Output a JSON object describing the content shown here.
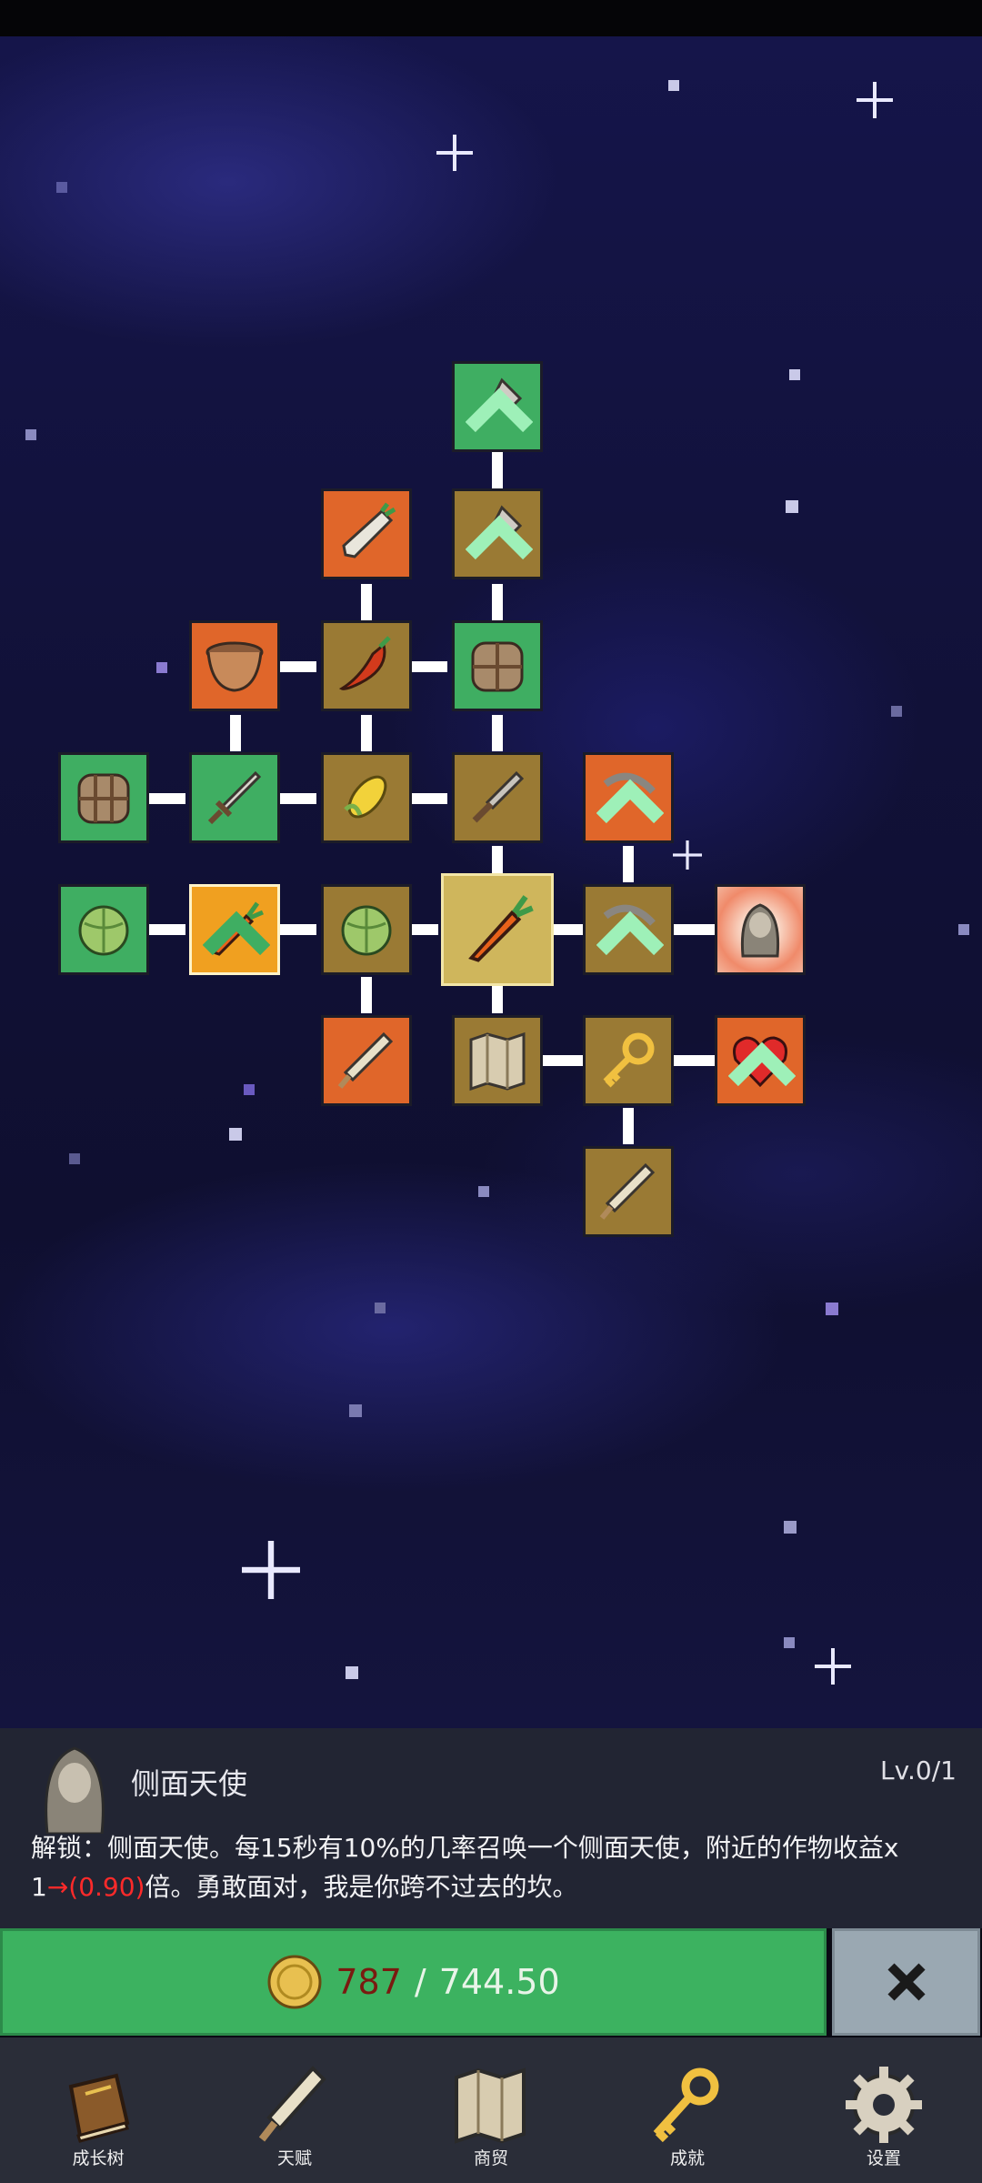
{
  "skill_tree": {
    "nodes": [
      {
        "id": "shovel-top",
        "icon": "shovel-icon",
        "color": "green",
        "upgrade": true
      },
      {
        "id": "radish",
        "icon": "radish-icon",
        "color": "orange",
        "upgrade": false
      },
      {
        "id": "shovel",
        "icon": "shovel-icon",
        "color": "gold",
        "upgrade": true
      },
      {
        "id": "pot",
        "icon": "pot-icon",
        "color": "orange",
        "upgrade": false
      },
      {
        "id": "chili",
        "icon": "chili-icon",
        "color": "gold",
        "upgrade": false
      },
      {
        "id": "bag-top",
        "icon": "bag-icon",
        "color": "green",
        "upgrade": false
      },
      {
        "id": "bag-left",
        "icon": "bag-icon",
        "color": "green",
        "upgrade": false
      },
      {
        "id": "sword",
        "icon": "sword-icon",
        "color": "green",
        "upgrade": false
      },
      {
        "id": "corn",
        "icon": "corn-icon",
        "color": "gold",
        "upgrade": false
      },
      {
        "id": "sickle",
        "icon": "sickle-icon",
        "color": "gold",
        "upgrade": false
      },
      {
        "id": "pickaxe-top",
        "icon": "pickaxe-icon",
        "color": "orange",
        "upgrade": true
      },
      {
        "id": "cabbage-left",
        "icon": "cabbage-icon",
        "color": "green",
        "upgrade": false
      },
      {
        "id": "carrot-selected",
        "icon": "carrot-icon",
        "color": "selected",
        "upgrade": true
      },
      {
        "id": "cabbage",
        "icon": "cabbage-icon",
        "color": "gold",
        "upgrade": false
      },
      {
        "id": "carrot-center",
        "icon": "carrot-icon",
        "color": "center",
        "upgrade": false
      },
      {
        "id": "pickaxe",
        "icon": "pickaxe-icon",
        "color": "gold",
        "upgrade": true
      },
      {
        "id": "angel",
        "icon": "angel-icon",
        "color": "peach",
        "upgrade": false
      },
      {
        "id": "scroll-orange",
        "icon": "scroll-icon",
        "color": "orange",
        "upgrade": false
      },
      {
        "id": "map",
        "icon": "map-icon",
        "color": "gold",
        "upgrade": false
      },
      {
        "id": "key",
        "icon": "key-icon",
        "color": "gold",
        "upgrade": false
      },
      {
        "id": "heart",
        "icon": "heart-icon",
        "color": "orange",
        "upgrade": true
      },
      {
        "id": "scroll-bottom",
        "icon": "scroll-icon",
        "color": "gold",
        "upgrade": false
      }
    ]
  },
  "detail": {
    "avatar_icon": "angel-icon",
    "title": "侧面天使",
    "level": "Lv.0/1",
    "desc_part1": "解锁：侧面天使。每15秒有10%的几率召唤一个侧面天使，附近的作物收益x",
    "desc_part2": "1",
    "desc_red": "→(0.90)",
    "desc_part3": "倍。勇敢面对，我是你跨不过去的坎。"
  },
  "purchase": {
    "coin_icon": "coin-icon",
    "have": "787",
    "separator": "/",
    "need": "744.50",
    "close_icon": "close-icon"
  },
  "nav": [
    {
      "label": "成长树",
      "icon": "book-icon"
    },
    {
      "label": "天赋",
      "icon": "scroll-icon"
    },
    {
      "label": "商贸",
      "icon": "map-icon"
    },
    {
      "label": "成就",
      "icon": "key-icon"
    },
    {
      "label": "设置",
      "icon": "gear-icon"
    }
  ],
  "colors": {
    "tile_green": "#3fae62",
    "tile_gold": "#9a7a34",
    "tile_orange": "#e0662a",
    "buy_button": "#3cb260",
    "cost_have": "#7a1a10",
    "desc_highlight": "#ff2a2a"
  }
}
